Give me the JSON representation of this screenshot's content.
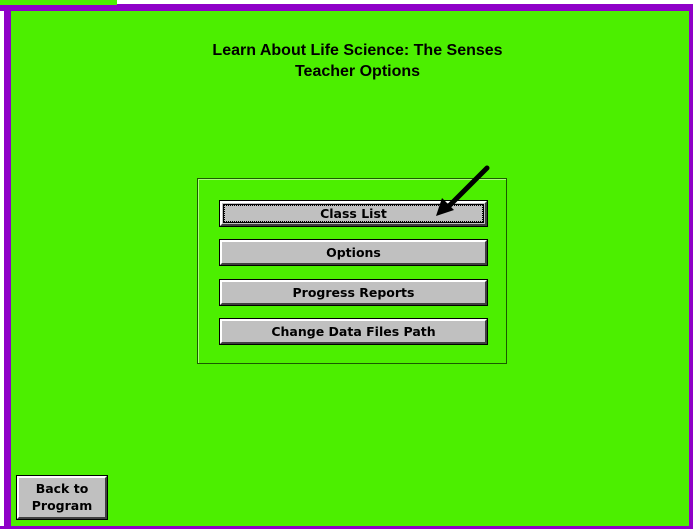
{
  "title": {
    "line1": "Learn About Life Science: The Senses",
    "line2": "Teacher Options"
  },
  "menu": {
    "buttons": [
      {
        "label": "Class List",
        "focused": true
      },
      {
        "label": "Options"
      },
      {
        "label": "Progress Reports"
      },
      {
        "label": "Change Data Files Path"
      }
    ]
  },
  "back_button": {
    "line1": "Back to",
    "line2": "Program"
  },
  "colors": {
    "background": "#4cef00",
    "frame": "#8f00c8",
    "button_face": "#c0c0c0"
  },
  "icons": {
    "pointer": "arrow-pointer-icon"
  }
}
